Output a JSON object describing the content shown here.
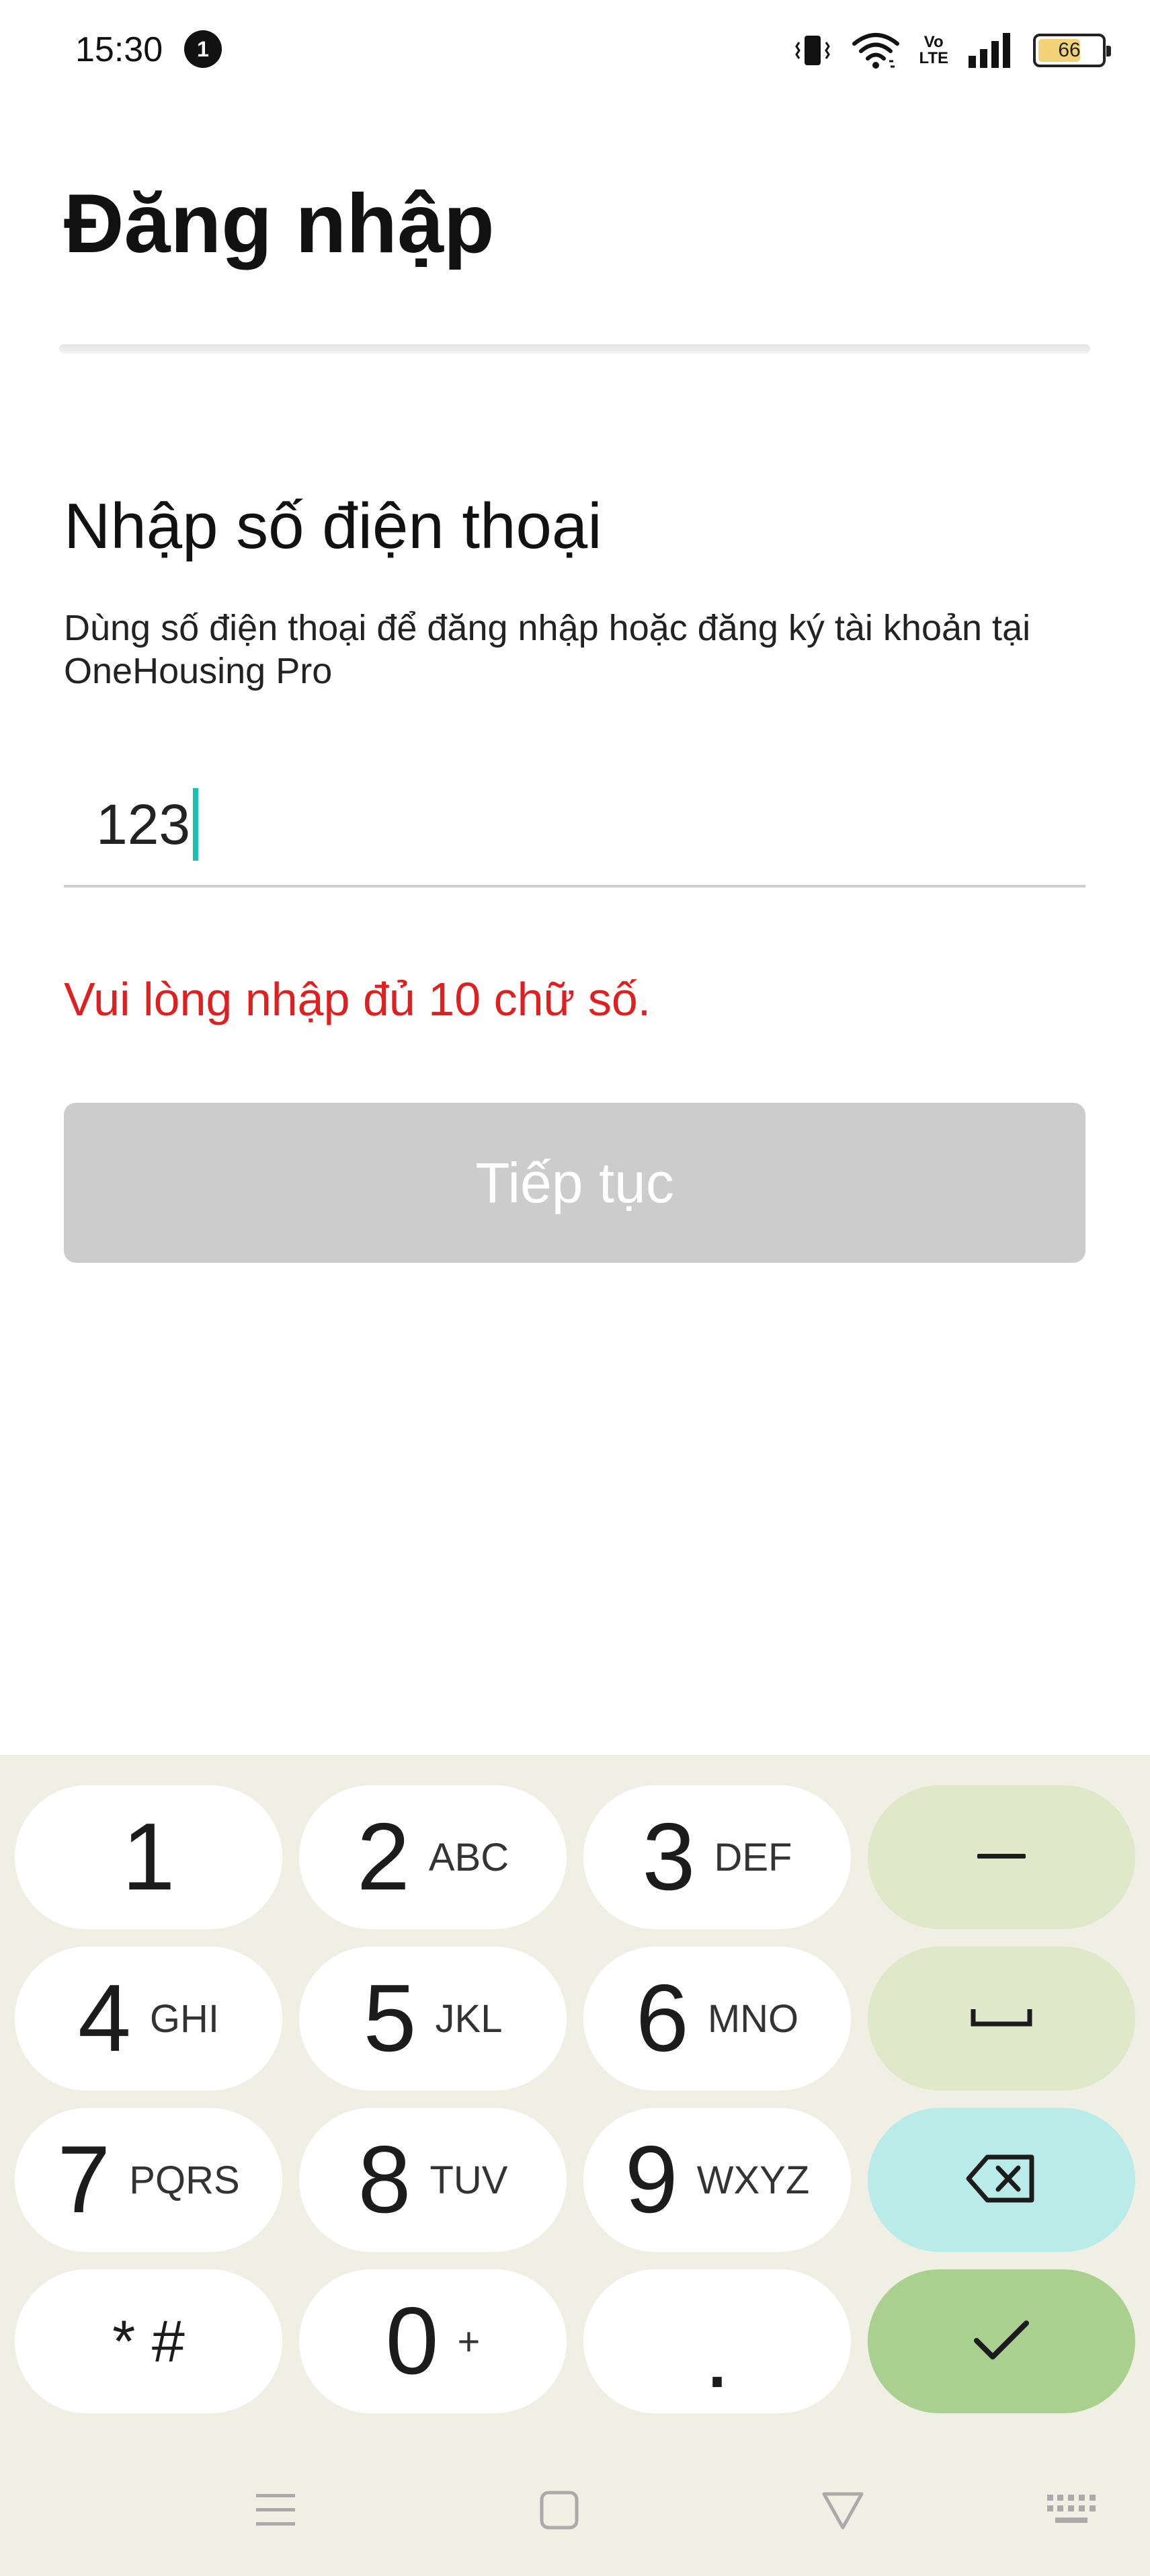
{
  "status_bar": {
    "time": "15:30",
    "notification_count": "1",
    "battery": "66",
    "icons": [
      "vibrate-icon",
      "wifi-icon",
      "volte-icon",
      "signal-icon",
      "battery-icon"
    ],
    "volte_label_top": "Vo",
    "volte_label_bottom": "LTE"
  },
  "header": {
    "title": "Đăng nhập"
  },
  "main": {
    "section_title": "Nhập số điện thoại",
    "description": "Dùng số điện thoại để đăng nhập hoặc đăng ký tài khoản tại OneHousing Pro",
    "phone_input_value": "123",
    "error_message": "Vui lòng nhập đủ 10 chữ số.",
    "continue_label": "Tiếp tục"
  },
  "keyboard": {
    "keys": [
      {
        "num": "1",
        "letters": ""
      },
      {
        "num": "2",
        "letters": "ABC"
      },
      {
        "num": "3",
        "letters": "DEF"
      },
      {
        "num": "4",
        "letters": "GHI"
      },
      {
        "num": "5",
        "letters": "JKL"
      },
      {
        "num": "6",
        "letters": "MNO"
      },
      {
        "num": "7",
        "letters": "PQRS"
      },
      {
        "num": "8",
        "letters": "TUV"
      },
      {
        "num": "9",
        "letters": "WXYZ"
      },
      {
        "num": "* #",
        "letters": ""
      },
      {
        "num": "0",
        "letters": "+"
      },
      {
        "num": ".",
        "letters": ""
      }
    ],
    "action_keys": [
      "minus-key",
      "space-key",
      "backspace-key",
      "done-key"
    ],
    "minus_label": "–"
  },
  "nav_bar": {
    "icons": [
      "menu-icon",
      "home-icon",
      "back-icon",
      "keyboard-icon"
    ]
  },
  "colors": {
    "error": "#e02020",
    "caret": "#19c2b0",
    "button_disabled": "#cccccc",
    "keyboard_bg": "#f0efe3",
    "action_key": "#dfe8c8",
    "backspace_key": "#b9ebe8",
    "done_key": "#a9d08e"
  }
}
